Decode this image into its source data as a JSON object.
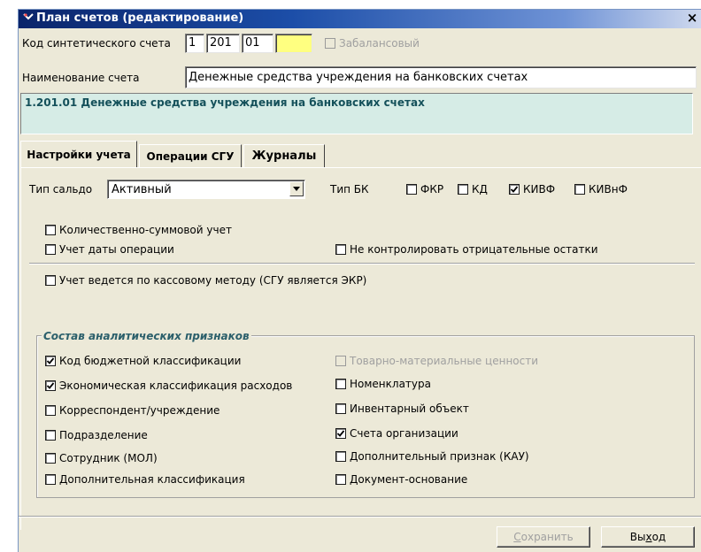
{
  "window": {
    "title": "План счетов (редактирование)",
    "close_glyph": "×"
  },
  "code_row": {
    "label": "Код синтетического счета",
    "parts": [
      "1",
      "201",
      "01",
      ""
    ],
    "offbalance": {
      "label": "Забалансовый",
      "checked": false,
      "disabled": true
    }
  },
  "name_row": {
    "label": "Наименование счета",
    "value": "Денежные средства учреждения на банковских счетах"
  },
  "info_text": "1.201.01 Денежные средства учреждения на банковских счетах",
  "tabs": [
    {
      "label": "Настройки учета",
      "active": true
    },
    {
      "label": "Операции СГУ",
      "active": false
    },
    {
      "label": "Журналы",
      "active": false
    }
  ],
  "settings": {
    "balance_type_label": "Тип сальдо",
    "balance_type_value": "Активный",
    "bk_type_label": "Тип БК",
    "bk_options": [
      {
        "label": "ФКР",
        "checked": false
      },
      {
        "label": "КД",
        "checked": false
      },
      {
        "label": "КИВФ",
        "checked": true
      },
      {
        "label": "КИВнФ",
        "checked": false
      }
    ],
    "qty_sum": "Количественно-суммовой учет",
    "op_date": "Учет даты операции",
    "no_neg": "Не контролировать отрицательные остатки",
    "cash_method": "Учет ведется по кассовому методу (СГУ является ЭКР)"
  },
  "analytics": {
    "title": "Состав аналитических признаков",
    "left": [
      {
        "label": "Код бюджетной классификации",
        "checked": true
      },
      {
        "label": "Экономическая классификация расходов",
        "checked": true
      },
      {
        "label": "Корреспондент/учреждение",
        "checked": false
      },
      {
        "label": "Подразделение",
        "checked": false
      },
      {
        "label": "Сотрудник (МОЛ)",
        "checked": false
      },
      {
        "label": "Дополнительная  классификация",
        "checked": false
      }
    ],
    "right": [
      {
        "label": "Товарно-материальные ценности",
        "checked": false,
        "disabled": true
      },
      {
        "label": "Номенклатура",
        "checked": false
      },
      {
        "label": "Инвентарный объект",
        "checked": false
      },
      {
        "label": "Счета организации",
        "checked": true
      },
      {
        "label": "Дополнительный признак (КАУ)",
        "checked": false
      },
      {
        "label": "Документ-основание",
        "checked": false
      }
    ]
  },
  "buttons": {
    "save_first": "С",
    "save_rest": "охранить",
    "exit_first": "Вы",
    "exit_u": "х",
    "exit_rest": "од"
  },
  "colors": {
    "title_start": "#0a246a",
    "info_bg": "#d6ece6",
    "info_text": "#14505a",
    "highlight_field": "#ffff80"
  }
}
